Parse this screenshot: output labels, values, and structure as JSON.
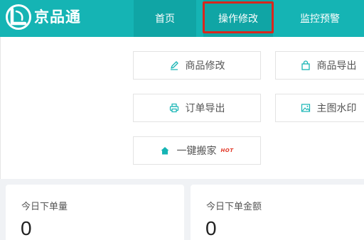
{
  "brand": {
    "name": "京品通"
  },
  "nav": {
    "home": "首页",
    "operations": "操作修改",
    "monitor": "监控预警"
  },
  "menu": {
    "items": [
      {
        "label": "商品修改",
        "icon": "pen-icon"
      },
      {
        "label": "商品导出",
        "icon": "bag-icon"
      },
      {
        "label": "订单导出",
        "icon": "printer-icon"
      },
      {
        "label": "主图水印",
        "icon": "image-icon"
      },
      {
        "label": "一键搬家",
        "icon": "home-icon",
        "badge": "HOT"
      }
    ]
  },
  "stats": [
    {
      "title": "今日下单量",
      "value": "0"
    },
    {
      "title": "今日下单金额",
      "value": "0"
    }
  ],
  "colors": {
    "accent": "#15b4b4",
    "highlight": "#d9261c",
    "hot": "#e23b2a"
  }
}
